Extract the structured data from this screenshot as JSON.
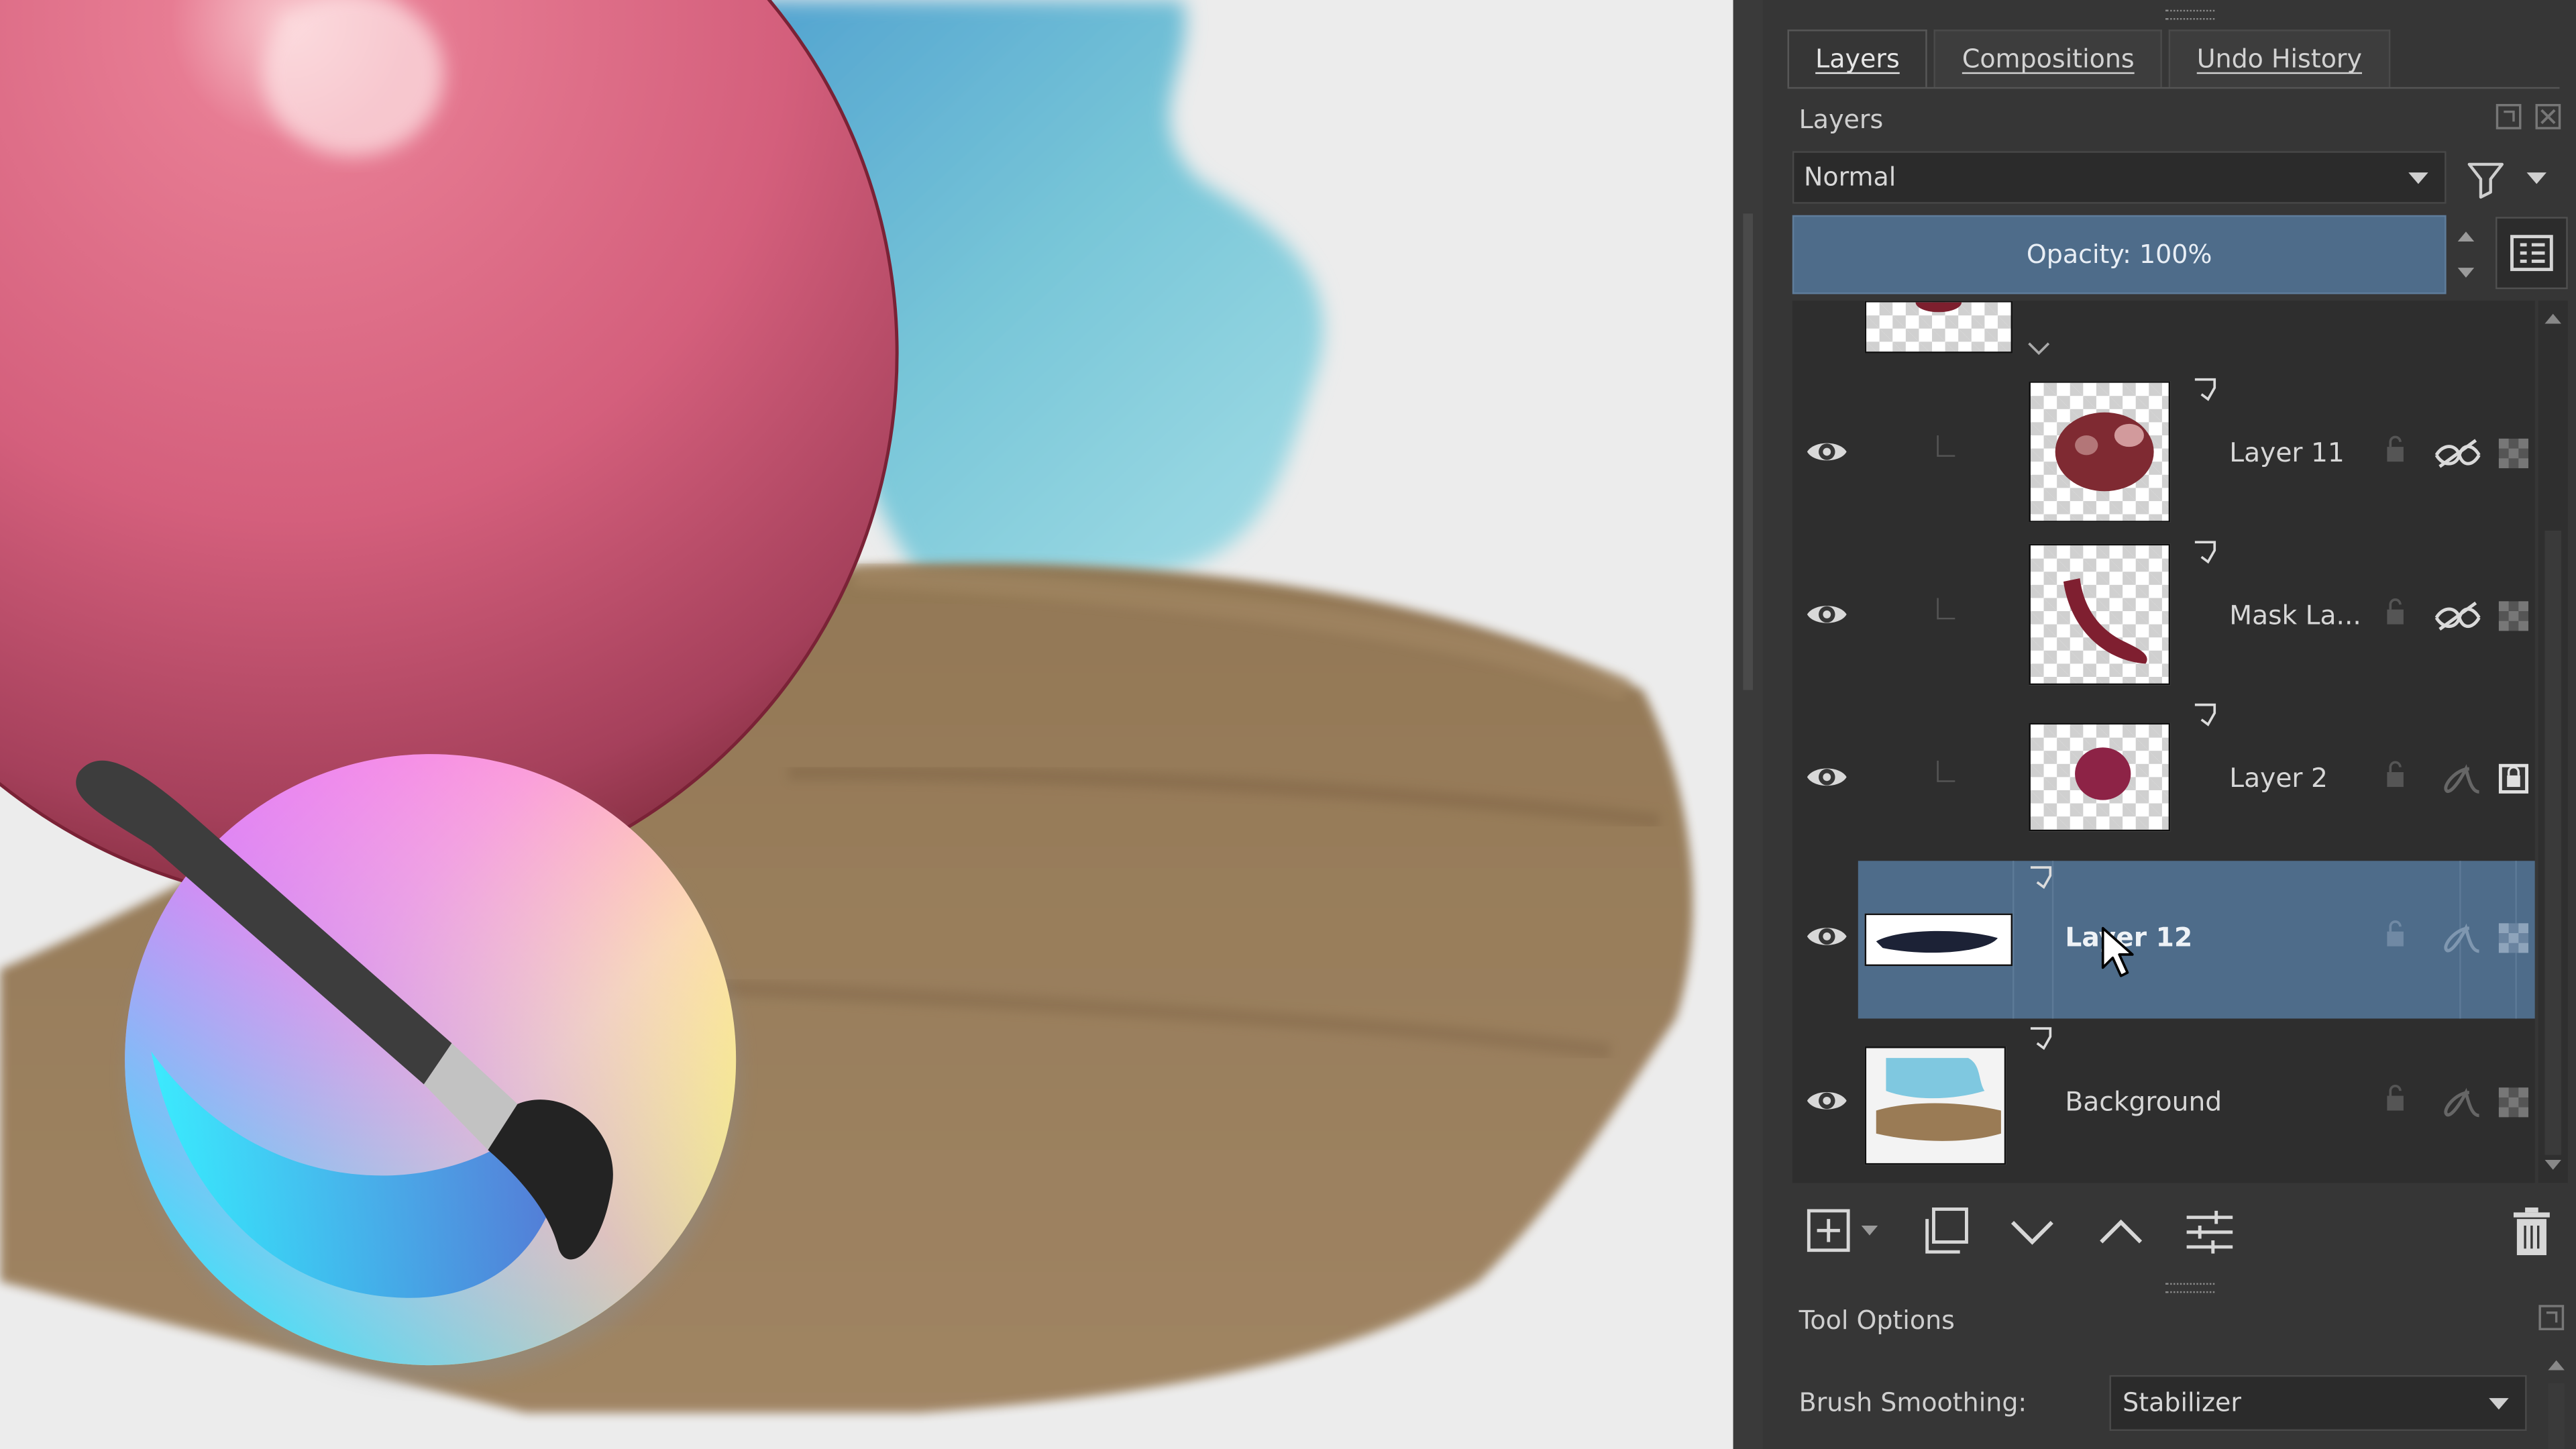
{
  "canvas": {
    "app_logo": "krita-logo",
    "colors": {
      "ball": "#d45f7c",
      "sky": "#7ec9d8",
      "ground": "#8e7452",
      "paper": "#ebebeb"
    }
  },
  "docker": {
    "tabs": [
      {
        "label": "Layers",
        "active": true
      },
      {
        "label": "Compositions",
        "active": false
      },
      {
        "label": "Undo History",
        "active": false
      }
    ],
    "title": "Layers",
    "blend_mode": "Normal",
    "opacity_label": "Opacity:  100%",
    "layers": [
      {
        "name": "Layer 11",
        "selected": false,
        "visible": true,
        "clipping_mask": true,
        "inherit_alpha": true
      },
      {
        "name": "Mask La...",
        "selected": false,
        "visible": true,
        "clipping_mask": true,
        "inherit_alpha": true
      },
      {
        "name": "Layer 2",
        "selected": false,
        "visible": true,
        "clipping_mask": true,
        "inherit_alpha": false
      },
      {
        "name": "Layer 12",
        "selected": true,
        "visible": true,
        "clipping_mask": true,
        "inherit_alpha": false
      },
      {
        "name": "Background",
        "selected": false,
        "visible": true,
        "clipping_mask": true,
        "inherit_alpha": false
      }
    ],
    "toolbar_icons": [
      "add-layer-icon",
      "duplicate-layer-icon",
      "move-down-icon",
      "move-up-icon",
      "layer-properties-icon",
      "delete-layer-icon"
    ]
  },
  "tool_options": {
    "title": "Tool Options",
    "brush_smoothing_label": "Brush Smoothing:",
    "brush_smoothing_value": "Stabilizer"
  },
  "accent": {
    "selection": "#4e6c8a",
    "panel": "#363636"
  }
}
